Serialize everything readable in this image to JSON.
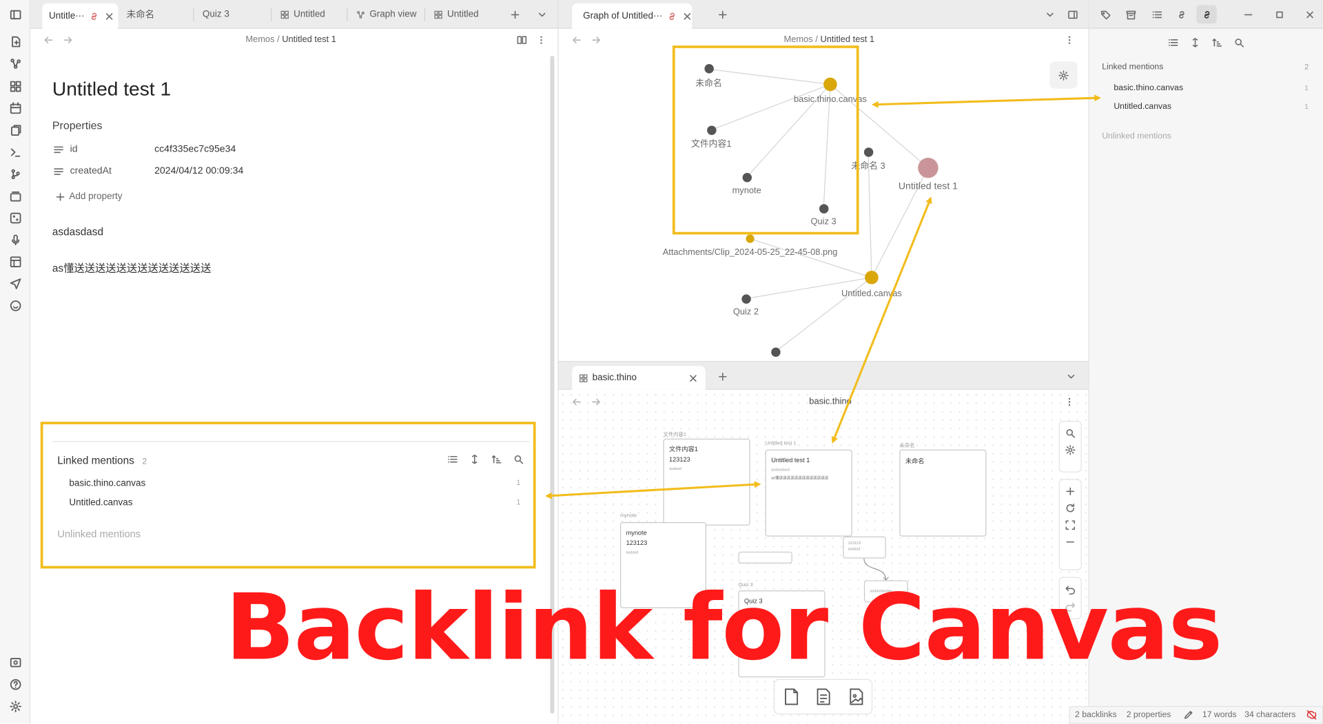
{
  "window": {
    "left_tabs": [
      "Untitle···",
      "未命名",
      "Quiz 3",
      "Untitled",
      "Graph view",
      "Untitled"
    ],
    "graph_tab": "Graph of Untitled···",
    "canvas_tab": "basic.thino"
  },
  "left_pane": {
    "breadcrumb_parent": "Memos",
    "breadcrumb_sep": "/",
    "breadcrumb_current": "Untitled test 1",
    "title": "Untitled test 1",
    "properties_heading": "Properties",
    "properties": [
      {
        "key": "id",
        "value": "cc4f335ec7c95e34"
      },
      {
        "key": "createdAt",
        "value": "2024/04/12 00:09:34"
      }
    ],
    "add_property": "Add property",
    "body_lines": [
      "asdasdasd",
      "as懂送送送送送送送送送送送送送"
    ],
    "linked_mentions_label": "Linked mentions",
    "linked_mentions_count": "2",
    "mentions": [
      {
        "name": "basic.thino.canvas",
        "count": "1"
      },
      {
        "name": "Untitled.canvas",
        "count": "1"
      }
    ],
    "unlinked_mentions": "Unlinked mentions"
  },
  "graph_pane": {
    "breadcrumb_parent": "Memos",
    "breadcrumb_sep": "/",
    "breadcrumb_current": "Untitled test 1",
    "nodes": [
      {
        "label": "未命名"
      },
      {
        "label": "basic.thino.canvas"
      },
      {
        "label": "文件内容1"
      },
      {
        "label": "mynote"
      },
      {
        "label": "Quiz 3"
      },
      {
        "label": "未命名 3"
      },
      {
        "label": "Untitled test 1"
      },
      {
        "label": "Attachments/Clip_2024-05-25_22-45-08.png"
      },
      {
        "label": "Untitled.canvas"
      },
      {
        "label": "Quiz 2"
      }
    ]
  },
  "canvas_pane": {
    "title": "basic.thino",
    "cards": [
      {
        "title": "文件内容1",
        "line1": "文件内容1",
        "line2": "123123",
        "line3": "asdasd"
      },
      {
        "title": "Untitled test 1",
        "line1": "Untitled test 1",
        "line2": "asdasdasd",
        "line3": "as懂送送送送送送送送送送送送送"
      },
      {
        "title": "未命名",
        "line1": "未命名"
      },
      {
        "title": "mynote",
        "line1": "mynote",
        "line2": "123123",
        "line3": "asdasd"
      },
      {
        "title": "Quiz 3",
        "line1": "Quiz 3"
      },
      {
        "line1": "123123",
        "line2": "asdasd"
      },
      {
        "line1": "asdasdasdas"
      }
    ]
  },
  "right_pane": {
    "linked_mentions_label": "Linked mentions",
    "linked_mentions_count": "2",
    "mentions": [
      {
        "name": "basic.thino.canvas",
        "count": "1"
      },
      {
        "name": "Untitled.canvas",
        "count": "1"
      }
    ],
    "unlinked_mentions": "Unlinked mentions"
  },
  "status_bar": {
    "backlinks": "2 backlinks",
    "properties": "2 properties",
    "words": "17 words",
    "characters": "34 characters"
  },
  "overlay_title": "Backlink for Canvas",
  "colors": {
    "highlight": "#f2bc1b",
    "overlay_text": "#ff1a1a",
    "node_gold": "#d9a70a",
    "node_active": "#c9959a",
    "node_default": "#555555"
  }
}
